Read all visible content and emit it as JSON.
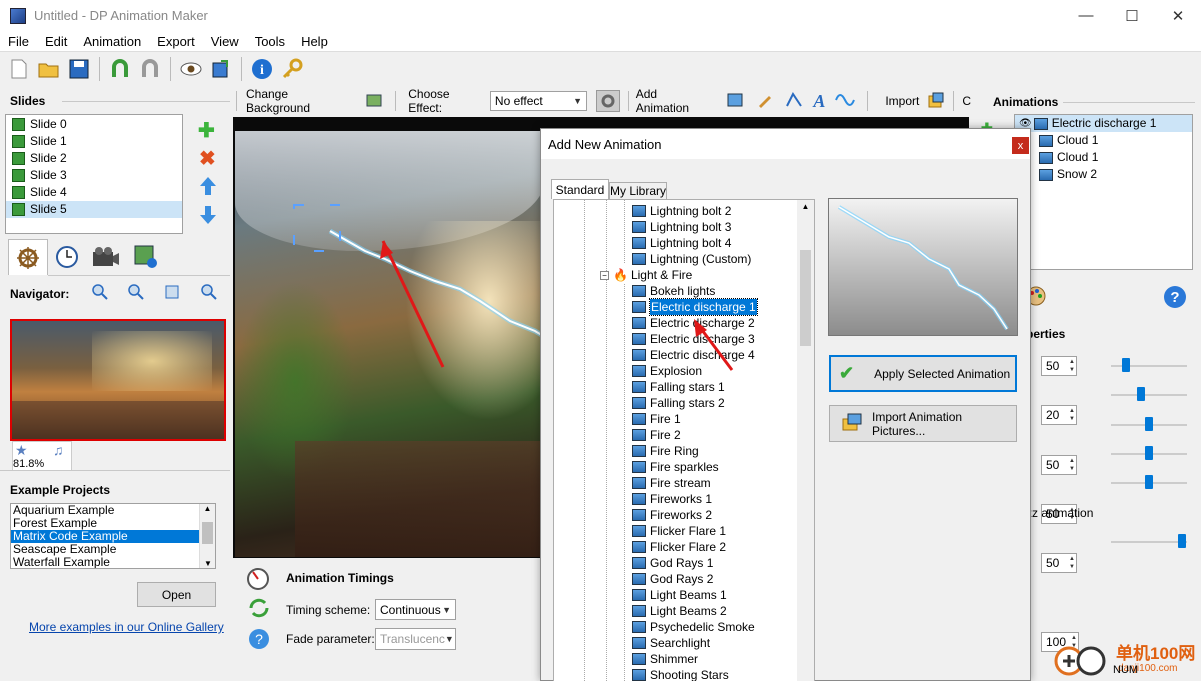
{
  "window": {
    "title": "Untitled - DP Animation Maker",
    "minimize": "—",
    "maximize": "☐",
    "close": "✕"
  },
  "menu": [
    "File",
    "Edit",
    "Animation",
    "Export",
    "View",
    "Tools",
    "Help"
  ],
  "left": {
    "slides_title": "Slides",
    "slides": [
      "Slide 0",
      "Slide 1",
      "Slide 2",
      "Slide 3",
      "Slide 4",
      "Slide 5"
    ],
    "navigator_label": "Navigator:",
    "zoom_value": "81.8%",
    "examples_title": "Example Projects",
    "examples": [
      "Aquarium Example",
      "Forest Example",
      "Matrix Code Example",
      "Seascape Example",
      "Waterfall Example"
    ],
    "open_button": "Open",
    "gallery_link": "More examples in our Online Gallery"
  },
  "canvas_toolbar": {
    "change_background": "Change Background",
    "choose_effect_label": "Choose Effect:",
    "effect_value": "No effect",
    "add_animation": "Add Animation",
    "import": "Import",
    "cut_char": "C"
  },
  "timings": {
    "title": "Animation Timings",
    "scheme_label": "Timing scheme:",
    "scheme_value": "Continuous",
    "fade_label": "Fade parameter:",
    "fade_value": "Translucenc"
  },
  "right": {
    "animations_title": "Animations",
    "animations": [
      "Electric discharge 1",
      "Cloud 1",
      "Cloud 1",
      "Snow 2"
    ],
    "properties_fragment": "perties",
    "values": [
      "50",
      "20",
      "50",
      "50",
      "50"
    ],
    "zz_label": "zz animation",
    "last_value": "100",
    "help_icon_text": "?"
  },
  "dialog": {
    "title": "Add New Animation",
    "close": "x",
    "tabs": [
      "Standard",
      "My Library"
    ],
    "tree_top": [
      "Lightning bolt 2",
      "Lightning bolt 3",
      "Lightning bolt 4",
      "Lightning (Custom)"
    ],
    "category": "Light & Fire",
    "tree_items": [
      "Bokeh lights",
      "Electric discharge 1",
      "Electric discharge 2",
      "Electric discharge 3",
      "Electric discharge 4",
      "Explosion",
      "Falling stars 1",
      "Falling stars 2",
      "Fire 1",
      "Fire 2",
      "Fire Ring",
      "Fire sparkles",
      "Fire stream",
      "Fireworks 1",
      "Fireworks 2",
      "Flicker Flare 1",
      "Flicker Flare 2",
      "God Rays 1",
      "God Rays 2",
      "Light Beams 1",
      "Light Beams 2",
      "Psychedelic Smoke",
      "Searchlight",
      "Shimmer",
      "Shooting Stars"
    ],
    "apply_button": "Apply Selected Animation",
    "import_button": "Import Animation Pictures..."
  },
  "watermark": {
    "text": "单机100网",
    "sub": "danji100.com",
    "num": "NUM"
  }
}
